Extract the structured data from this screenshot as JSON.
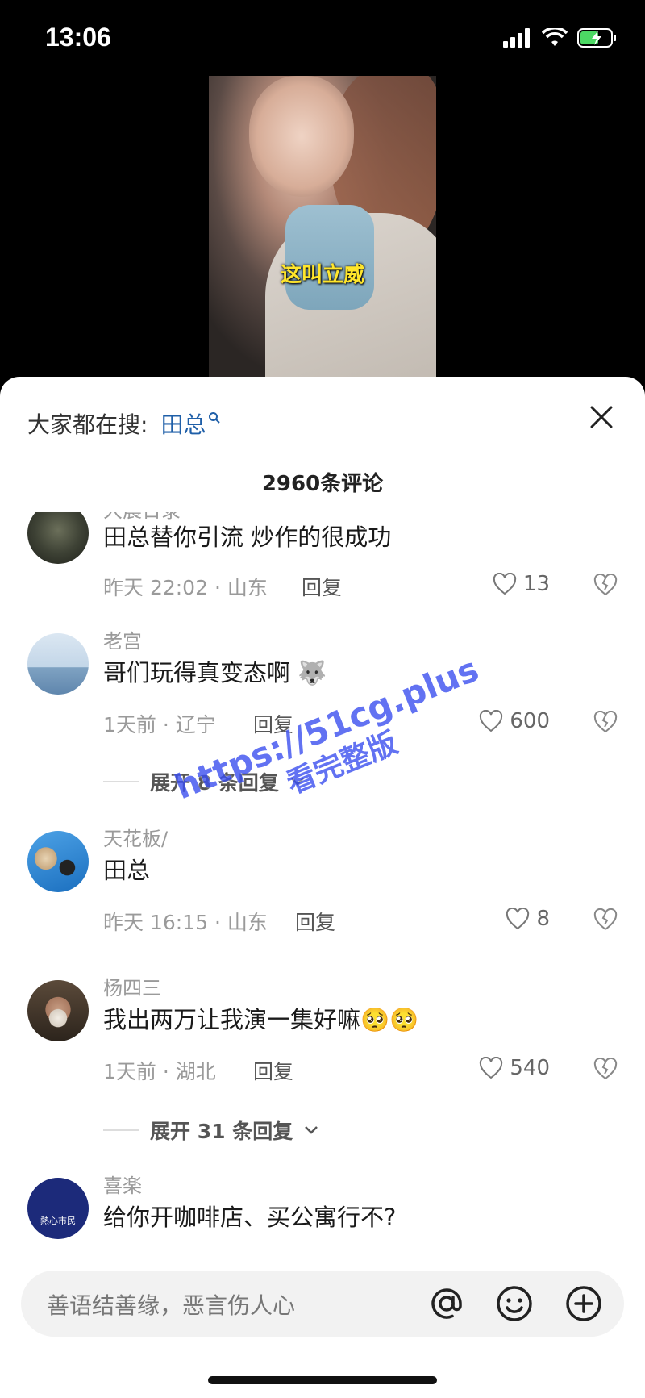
{
  "status_bar": {
    "time": "13:06"
  },
  "video": {
    "caption": "这叫立威"
  },
  "sheet": {
    "search_prefix": "大家都在搜:",
    "search_term": "田总",
    "comment_count": "2960条评论"
  },
  "comments": [
    {
      "author": "大晨日录",
      "text": "田总替你引流 炒作的很成功",
      "meta": "昨天 22:02 · 山东",
      "reply": "回复",
      "likes": "13"
    },
    {
      "author": "老宫",
      "text": "哥们玩得真变态啊",
      "emoji": "🐺",
      "meta": "1天前 · 辽宁",
      "reply": "回复",
      "likes": "600",
      "expand": "展开 8 条回复"
    },
    {
      "author": "天花板/",
      "text": "田总",
      "meta": "昨天 16:15 · 山东",
      "reply": "回复",
      "likes": "8"
    },
    {
      "author": "杨四三",
      "text": "我出两万让我演一集好嘛",
      "emoji": "🥺🥺",
      "meta": "1天前 · 湖北",
      "reply": "回复",
      "likes": "540",
      "expand": "展开 31 条回复"
    },
    {
      "author": "喜楽",
      "avatar_text": "熱心市民",
      "text": "给你开咖啡店、买公寓行不?"
    }
  ],
  "watermark": {
    "line1": "https://51cg.plus",
    "line2": "看完整版"
  },
  "input": {
    "placeholder": "善语结善缘，恶言伤人心"
  },
  "icons": {
    "signal": "signal-icon",
    "wifi": "wifi-icon",
    "battery": "battery-charging-icon",
    "close": "close-icon",
    "search": "search-icon",
    "heart": "heart-icon",
    "dislike": "broken-heart-icon",
    "mention": "at-icon",
    "emoji": "smiley-icon",
    "add": "plus-icon"
  },
  "colors": {
    "search_term": "#1f5fa8",
    "caption": "#ffe62b",
    "battery": "#4cd964",
    "watermark": "#3b4ff0"
  }
}
